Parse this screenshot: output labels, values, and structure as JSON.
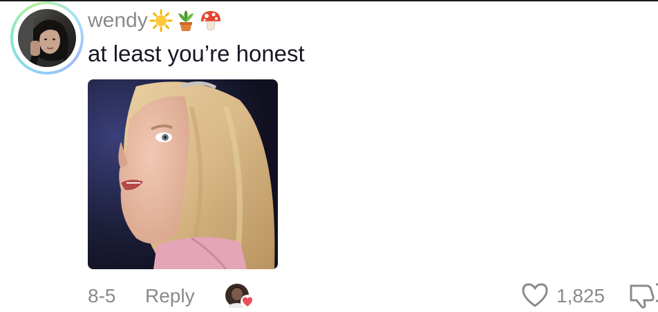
{
  "comment": {
    "username": "wendy",
    "username_emojis": [
      "sun-emoji",
      "potted-plant-emoji",
      "mushroom-emoji"
    ],
    "text": "at least you’re honest",
    "attachment": "gif-image",
    "date": "8-5",
    "reply_label": "Reply",
    "like_count": "1,825",
    "liked_by_creator": true
  },
  "colors": {
    "text_primary": "#161823",
    "text_secondary": "#8a8a8a",
    "creator_heart": "#fe2c55",
    "avatar_ring": [
      "#8fd3f4",
      "#84e8c8",
      "#b9ef9f"
    ]
  },
  "icons": {
    "like": "heart-outline-icon",
    "dislike": "thumbs-down-icon"
  }
}
